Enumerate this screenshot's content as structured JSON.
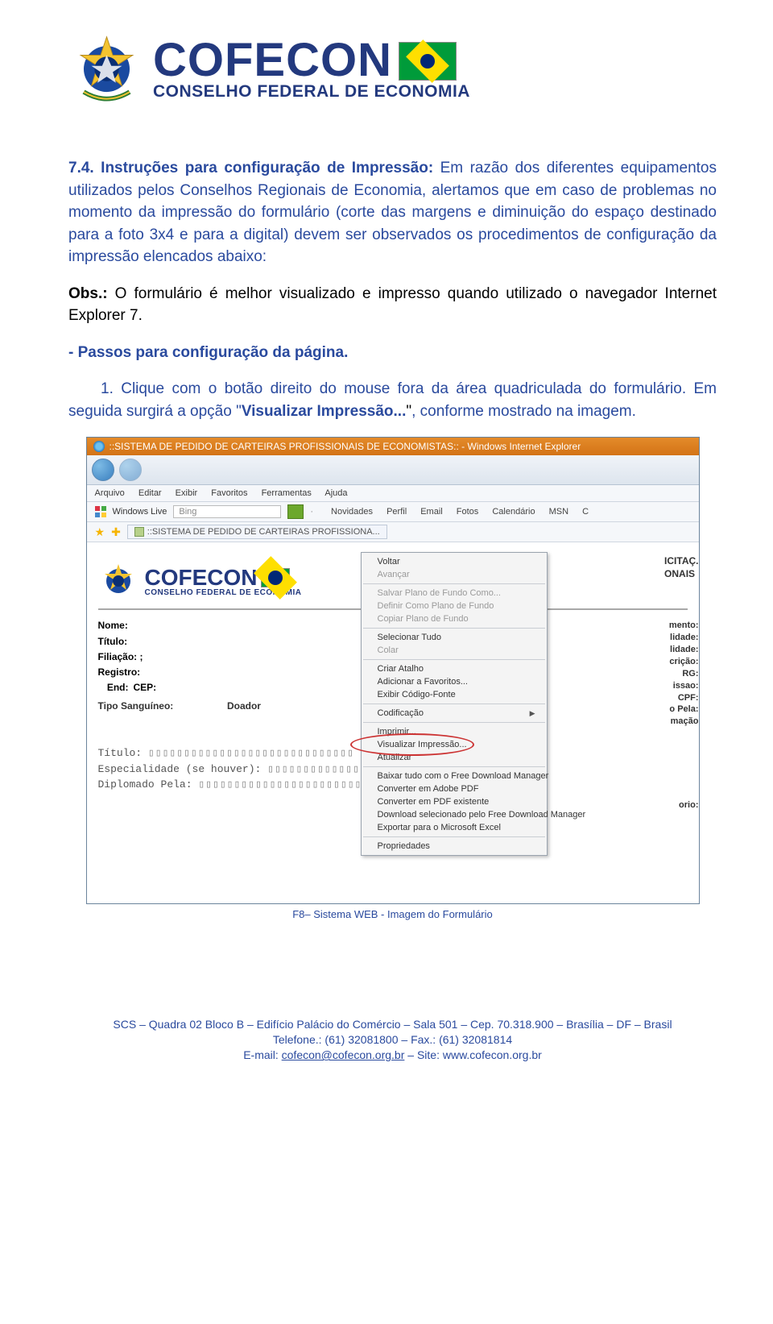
{
  "header": {
    "brand": "COFECON",
    "subtitle": "CONSELHO FEDERAL DE ECONOMIA"
  },
  "section": {
    "heading_prefix": "7.4. Instruções para configuração de Impressão:",
    "heading_rest": " Em razão dos diferentes equipamentos utilizados pelos Conselhos Regionais de Economia, alertamos que em caso de problemas no momento da impressão do formulário (corte das margens e diminuição do espaço destinado para a foto 3x4 e para a digital) devem ser observados os procedimentos de configuração da impressão elencados abaixo:",
    "obs_label": "Obs.:",
    "obs_text": " O formulário é melhor visualizado e impresso quando utilizado o navegador Internet Explorer 7.",
    "passos": "- Passos para configuração da página.",
    "step1_num": "1.",
    "step1_a": " Clique com o botão direito do mouse fora da área quadriculada do formulário. Em seguida surgirá a opção \"",
    "step1_bold": "Visualizar Impressão...",
    "step1_b": ", conforme mostrado na imagem."
  },
  "ie": {
    "title": "::SISTEMA DE PEDIDO DE CARTEIRAS PROFISSIONAIS DE ECONOMISTAS:: - Windows Internet Explorer",
    "menu": [
      "Arquivo",
      "Editar",
      "Exibir",
      "Favoritos",
      "Ferramentas",
      "Ajuda"
    ],
    "winlive": "Windows Live",
    "bing": "Bing",
    "links": [
      "Novidades",
      "Perfil",
      "Email",
      "Fotos",
      "Calendário",
      "MSN",
      "C"
    ],
    "tab": "::SISTEMA DE PEDIDO DE CARTEIRAS PROFISSIONA...",
    "inner_brand": "COFECON",
    "inner_sub": "CONSELHO FEDERAL DE ECONOMIA",
    "right_top": [
      "ICITAÇ.",
      "ONAIS"
    ],
    "fields": {
      "nome": "Nome:",
      "titulo": "Título:",
      "filiacao": "Filiação: ;",
      "registro": "Registro:",
      "end": "End:",
      "cep": "CEP:",
      "tipo": "Tipo Sanguíneo:",
      "doador": "Doador"
    },
    "right_fields": [
      "mento:",
      "lidade:",
      "lidade:",
      "crição:",
      "RG:",
      "issao:",
      "CPF:",
      "o Pela:",
      "mação"
    ],
    "right_bottom": "orio:",
    "mono": {
      "l1": "Título:",
      "l2": "Especialidade (se houver):",
      "l3": "Diplomado Pela:"
    },
    "context": {
      "voltar": "Voltar",
      "avancar": "Avançar",
      "salvar_fundo": "Salvar Plano de Fundo Como...",
      "definir_fundo": "Definir Como Plano de Fundo",
      "copiar_fundo": "Copiar Plano de Fundo",
      "selecionar": "Selecionar Tudo",
      "colar": "Colar",
      "criar_atalho": "Criar Atalho",
      "add_fav": "Adicionar a Favoritos...",
      "exibir_fonte": "Exibir Código-Fonte",
      "codificacao": "Codificação",
      "imprimir": "Imprimir...",
      "visualizar": "Visualizar Impressão...",
      "atualizar": "Atualizar",
      "baixar_fdm": "Baixar tudo com o Free Download Manager",
      "conv_adobe": "Converter em Adobe PDF",
      "conv_exist": "Converter em PDF existente",
      "dl_sel_fdm": "Download selecionado pelo Free Download Manager",
      "exp_excel": "Exportar para o Microsoft Excel",
      "props": "Propriedades"
    }
  },
  "caption": "F8– Sistema WEB - Imagem do Formulário",
  "footer": {
    "l1": "SCS – Quadra 02 Bloco B – Edifício Palácio do Comércio – Sala 501 – Cep. 70.318.900 – Brasília – DF – Brasil",
    "l2": "Telefone.: (61) 32081800 – Fax.: (61) 32081814",
    "l3a": "E-mail: ",
    "l3_email": "cofecon@cofecon.org.br",
    "l3b": " – Site: www.cofecon.org.br"
  }
}
